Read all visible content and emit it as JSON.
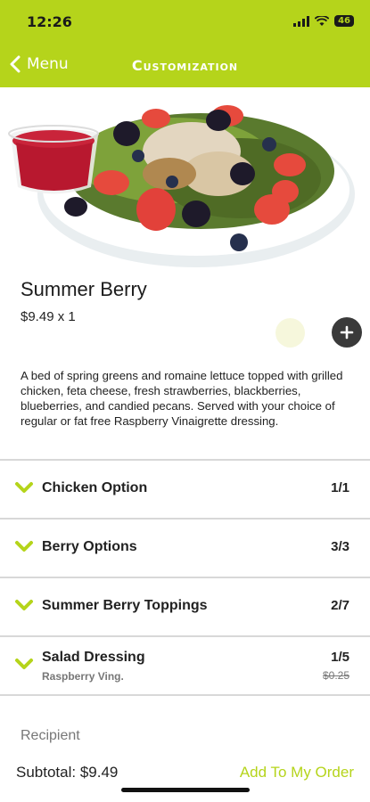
{
  "status_bar": {
    "time": "12:26",
    "battery": "46"
  },
  "nav": {
    "back_label": "Menu",
    "title": "Customization"
  },
  "item": {
    "name": "Summer Berry",
    "price": "$9.49 x 1",
    "description": "A bed of spring greens and romaine lettuce topped with grilled chicken, feta cheese, fresh strawberries, blackberries, blueberries, and candied pecans.  Served with your choice of regular or fat free Raspberry Vinaigrette dressing."
  },
  "options": [
    {
      "label": "Chicken Option",
      "count": "1/1"
    },
    {
      "label": "Berry Options",
      "count": "3/3"
    },
    {
      "label": "Summer Berry Toppings",
      "count": "2/7"
    },
    {
      "label": "Salad Dressing",
      "count": "1/5",
      "selection": "Raspberry Ving.",
      "extra_price": "$0.25"
    }
  ],
  "footer": {
    "recipient_label": "Recipient",
    "subtotal": "Subtotal: $9.49",
    "add_button": "Add To My Order"
  },
  "colors": {
    "accent": "#b5d41b",
    "dark": "#3a3a3a"
  }
}
